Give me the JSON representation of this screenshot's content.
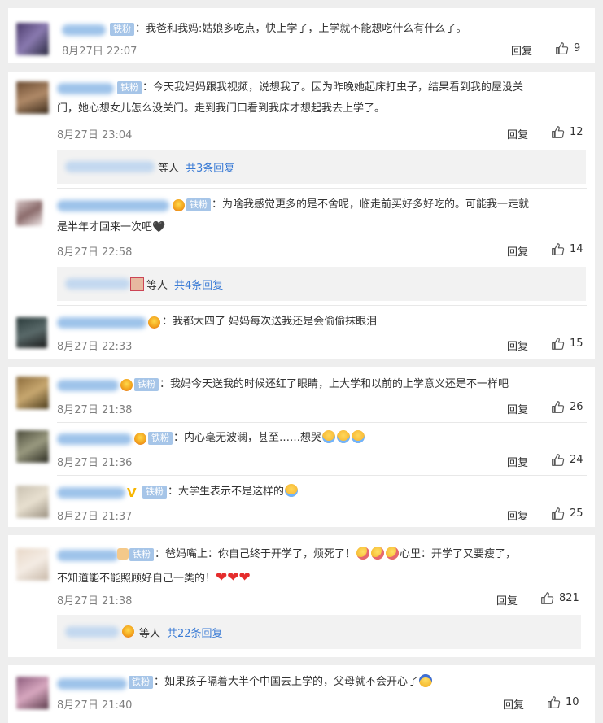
{
  "comments": {
    "c1": {
      "badge": "铁粉",
      "text": "：我爸和我妈:姑娘多吃点，快上学了，上学就不能想吃什么有什么了。",
      "time": "8月27日 22:07",
      "reply": "回复",
      "likes": "9"
    },
    "c2": {
      "badge": "铁粉",
      "text1": "：今天我妈妈跟我视频，说想我了。因为昨晚她起床打虫子，结果看到我的屋没关",
      "text2": "门，她心想女儿怎么没关门。走到我门口看到我床才想起我去上学了。",
      "time": "8月27日 23:04",
      "reply": "回复",
      "likes": "12",
      "sub": {
        "prefix": "等人",
        "more": "共3条回复"
      }
    },
    "c2r1": {
      "badge": "铁粉",
      "text1": "：为啥我感觉更多的是不舍呢，临走前买好多好吃的。可能我一走就",
      "text2": "是半年才回来一次吧",
      "heart": "🖤",
      "time": "8月27日 22:58",
      "reply": "回复",
      "likes": "14",
      "sub": {
        "prefix": "等人",
        "more": "共4条回复"
      }
    },
    "c2r2": {
      "text": "：我都大四了 妈妈每次送我还是会偷偷抹眼泪",
      "time": "8月27日 22:33",
      "reply": "回复",
      "likes": "15"
    },
    "c3": {
      "badge": "铁粉",
      "text": "：我妈今天送我的时候还红了眼睛，上大学和以前的上学意义还是不一样吧",
      "time": "8月27日 21:38",
      "reply": "回复",
      "likes": "26"
    },
    "c3r1": {
      "badge": "铁粉",
      "text": "：内心毫无波澜，甚至……想哭",
      "time": "8月27日 21:36",
      "reply": "回复",
      "likes": "24"
    },
    "c3r2": {
      "badge": "铁粉",
      "text": "：大学生表示不是这样的",
      "time": "8月27日 21:37",
      "reply": "回复",
      "likes": "25"
    },
    "c4": {
      "badge": "铁粉",
      "text1": "：爸妈嘴上：你自己终于开学了，烦死了！",
      "text1b": "心里：开学了又要瘦了，",
      "text2": "不知道能不能照顾好自己一类的！",
      "hearts": "❤❤❤",
      "time": "8月27日 21:38",
      "reply": "回复",
      "likes": "821",
      "sub": {
        "prefix": "等人",
        "more": "共22条回复"
      }
    },
    "c5": {
      "badge": "铁粉",
      "text": "：如果孩子隔着大半个中国去上学的，父母就不会开心了",
      "time": "8月27日 21:40",
      "reply": "回复",
      "likes": "10"
    }
  },
  "colors": {
    "link": "#3a7bd5",
    "badge": "#a6c5e8",
    "meta": "#808080",
    "background": "#eeeeee"
  },
  "icons": {
    "like": "thumbs-up-icon",
    "medal": "fan-medal-icon",
    "verified": "v-verified-icon"
  }
}
